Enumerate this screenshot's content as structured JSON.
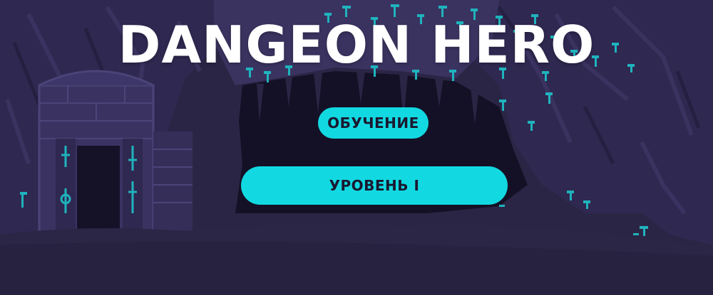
{
  "game": {
    "title": "DANGEON HERO"
  },
  "menu": {
    "tutorial_label": "ОБУЧЕНИЕ",
    "level1_label": "УРОВЕНЬ I"
  },
  "colors": {
    "button": "#12d9e1",
    "button_text": "#1a1830",
    "title": "#ffffff",
    "crystal": "#1fb3bd",
    "cave_dark": "#141126",
    "cave_mid": "#2d2749",
    "cave_light": "#3b3460"
  }
}
